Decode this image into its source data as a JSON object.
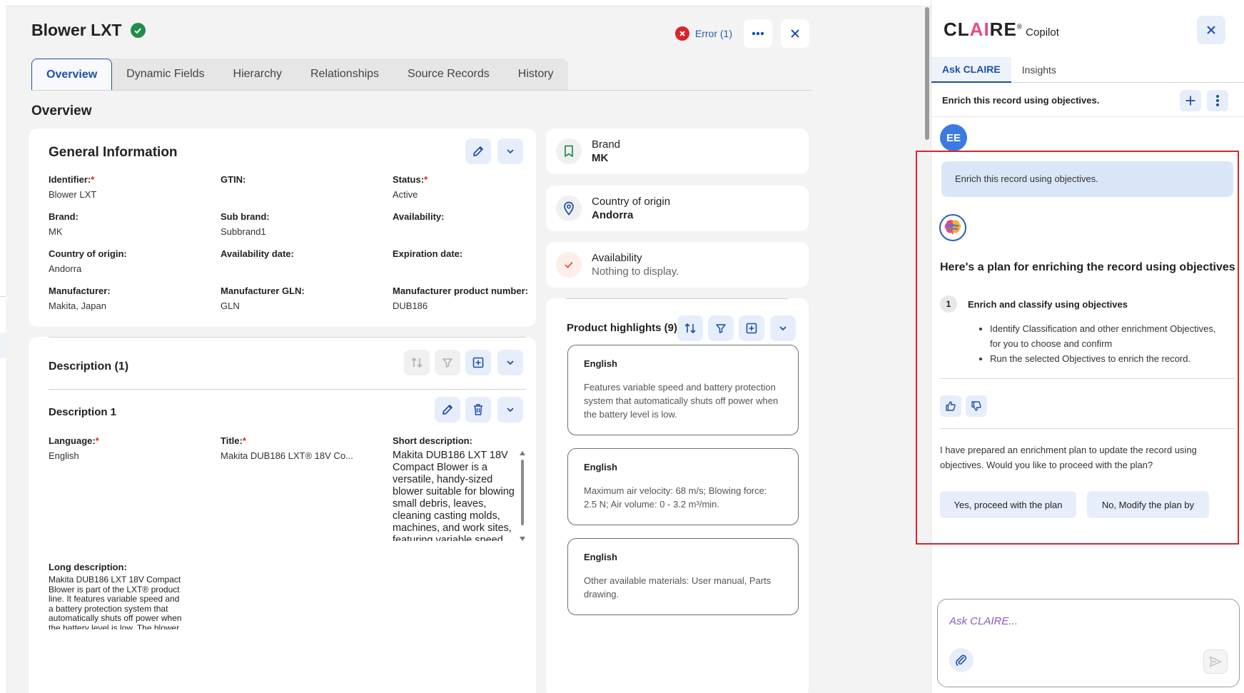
{
  "record": {
    "title": "Blower LXT",
    "error_label": "Error (1)"
  },
  "tabs": [
    "Overview",
    "Dynamic Fields",
    "Hierarchy",
    "Relationships",
    "Source Records",
    "History"
  ],
  "section_title": "Overview",
  "general_info": {
    "title": "General Information",
    "fields": [
      {
        "label": "Identifier:",
        "required": "*",
        "value": "Blower LXT"
      },
      {
        "label": "GTIN:",
        "required": "",
        "value": ""
      },
      {
        "label": "Status:",
        "required": "*",
        "value": "Active"
      },
      {
        "label": "Brand:",
        "required": "",
        "value": "MK"
      },
      {
        "label": "Sub brand:",
        "required": "",
        "value": "Subbrand1"
      },
      {
        "label": "Availability:",
        "required": "",
        "value": ""
      },
      {
        "label": "Country of origin:",
        "required": "",
        "value": "Andorra"
      },
      {
        "label": "Availability date:",
        "required": "",
        "value": ""
      },
      {
        "label": "Expiration date:",
        "required": "",
        "value": ""
      },
      {
        "label": "Manufacturer:",
        "required": "",
        "value": "Makita, Japan"
      },
      {
        "label": "Manufacturer GLN:",
        "required": "",
        "value": "GLN"
      },
      {
        "label": "Manufacturer product number:",
        "required": "",
        "value": "DUB186"
      }
    ]
  },
  "description": {
    "title": "Description (1)",
    "item_title": "Description 1",
    "language_label": "Language:",
    "language_required": "*",
    "language_value": "English",
    "title_label": "Title:",
    "title_required": "*",
    "title_value": "Makita DUB186 LXT® 18V Co...",
    "short_label": "Short description:",
    "short_value": "Makita DUB186 LXT 18V Compact Blower is a versatile, handy-sized blower suitable for blowing small debris, leaves, cleaning casting molds, machines, and work sites, featuring variable speed",
    "long_label": "Long description:",
    "long_value": "Makita DUB186 LXT 18V Compact Blower is part of the LXT® product line. It features variable speed and a battery protection system that automatically shuts off power when the battery level is low. The blower"
  },
  "side_cards": [
    {
      "label": "Brand",
      "value": "MK",
      "icon": "bookmark-icon"
    },
    {
      "label": "Country of origin",
      "value": "Andorra",
      "icon": "location-pin-icon"
    },
    {
      "label": "Availability",
      "value": "Nothing to display.",
      "icon": "check-icon"
    }
  ],
  "highlights": {
    "title": "Product highlights (9)",
    "items": [
      {
        "lang": "English",
        "text": "Features variable speed and battery protection system that automatically shuts off power when the battery level is low."
      },
      {
        "lang": "English",
        "text": "Maximum air velocity: 68 m/s; Blowing force: 2.5 N; Air volume: 0 - 3.2 m³/min."
      },
      {
        "lang": "English",
        "text": "Other available materials: User manual, Parts drawing."
      }
    ]
  },
  "copilot": {
    "logo_main_a": "CL",
    "logo_main_b": "AI",
    "logo_main_c": "RE",
    "logo_sup": "®",
    "logo_sub": "Copilot",
    "tabs": [
      "Ask CLAIRE",
      "Insights"
    ],
    "header_text": "Enrich this record using objectives.",
    "avatar": "EE",
    "user_message": "Enrich this record using objectives.",
    "plan_title": "Here's a plan for enriching the record using objectives",
    "step_number": "1",
    "step_label": "Enrich and classify using objectives",
    "bullets": [
      "Identify Classification and other enrichment Objectives, for you to choose and confirm",
      "Run the selected Objectives to enrich the record."
    ],
    "followup": "I have prepared an enrichment plan to update the record using objectives. Would you like to proceed with the plan?",
    "choice_yes": "Yes, proceed with the plan",
    "choice_no": "No, Modify the plan by",
    "input_placeholder": "Ask CLAIRE..."
  },
  "colors": {
    "accent": "#1c4fa8",
    "error": "#d9242b",
    "success": "#1f8f4a",
    "highlight_border": "#d8262c"
  }
}
